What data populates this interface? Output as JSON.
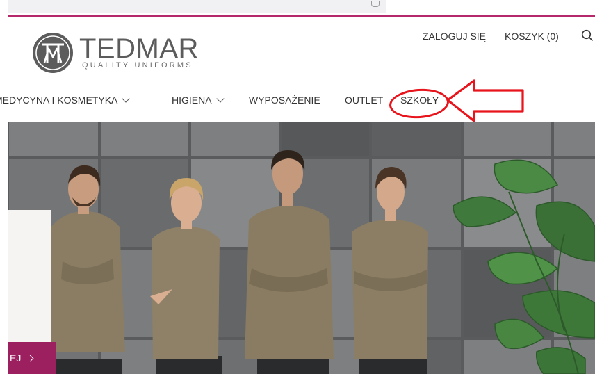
{
  "brand": {
    "name": "TEDMAR",
    "tagline": "QUALITY UNIFORMS",
    "accent_color": "#b5286a",
    "logo_color": "#5d5c5c"
  },
  "header": {
    "login_label": "ZALOGUJ SIĘ",
    "cart_label": "KOSZYK (0)",
    "search_icon": "search-icon"
  },
  "nav": {
    "items": [
      {
        "label": "MEDYCYNA I KOSMETYKA",
        "has_dropdown": true
      },
      {
        "label": "HIGIENA",
        "has_dropdown": true
      },
      {
        "label": "WYPOSAŻENIE",
        "has_dropdown": false
      },
      {
        "label": "OUTLET",
        "has_dropdown": false
      },
      {
        "label": "SZKOŁY",
        "has_dropdown": false
      }
    ]
  },
  "annotation": {
    "color": "#e8141c",
    "highlighted_item": "SZKOŁY"
  },
  "hero": {
    "cta_label": "EJ",
    "cta_color": "#9c1f60"
  }
}
